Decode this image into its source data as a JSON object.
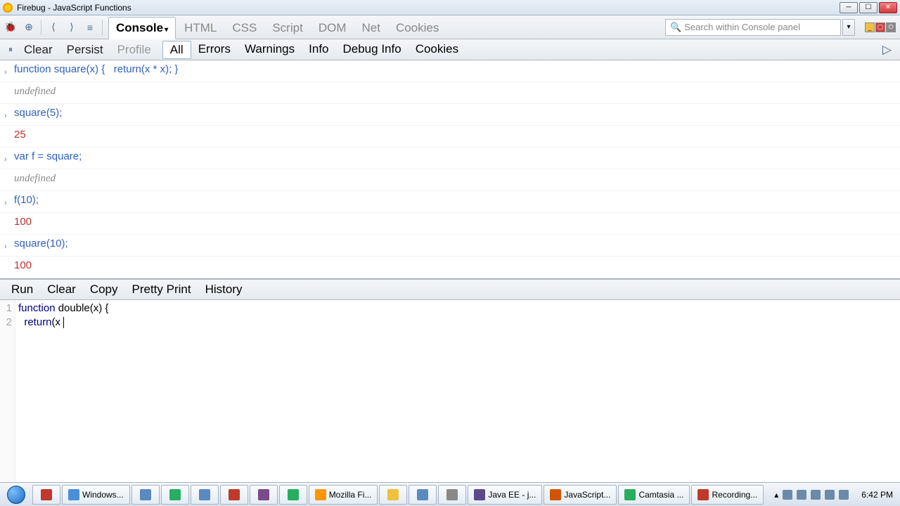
{
  "window": {
    "title": "Firebug - JavaScript Functions"
  },
  "panel_tabs": [
    "Console",
    "HTML",
    "CSS",
    "Script",
    "DOM",
    "Net",
    "Cookies"
  ],
  "active_panel": "Console",
  "search": {
    "placeholder": "Search within Console panel"
  },
  "console_toolbar": {
    "clear": "Clear",
    "persist": "Persist",
    "profile": "Profile"
  },
  "filters": [
    "All",
    "Errors",
    "Warnings",
    "Info",
    "Debug Info",
    "Cookies"
  ],
  "selected_filter": "All",
  "log": [
    {
      "kind": "cmd",
      "text": "function square(x) {   return(x * x); }"
    },
    {
      "kind": "undef",
      "text": "undefined"
    },
    {
      "kind": "cmd",
      "text": "square(5);"
    },
    {
      "kind": "out",
      "text": "25"
    },
    {
      "kind": "cmd",
      "text": "var f = square;"
    },
    {
      "kind": "undef",
      "text": "undefined"
    },
    {
      "kind": "cmd",
      "text": "f(10);"
    },
    {
      "kind": "out",
      "text": "100"
    },
    {
      "kind": "cmd",
      "text": "square(10);"
    },
    {
      "kind": "out",
      "text": "100"
    }
  ],
  "editor_toolbar": [
    "Run",
    "Clear",
    "Copy",
    "Pretty Print",
    "History"
  ],
  "editor_lines": [
    {
      "n": "1",
      "tokens": [
        [
          "kw",
          "function"
        ],
        [
          "plain",
          " double(x) {"
        ]
      ]
    },
    {
      "n": "2",
      "tokens": [
        [
          "plain",
          "  "
        ],
        [
          "kw",
          "return"
        ],
        [
          "plain",
          "(x "
        ]
      ],
      "caret": true
    }
  ],
  "taskbar": {
    "items": [
      {
        "label": "",
        "ico": "#c0392b"
      },
      {
        "label": "Windows...",
        "ico": "#4a90d9"
      },
      {
        "label": "",
        "ico": "#5a8ac0"
      },
      {
        "label": "",
        "ico": "#27ae60"
      },
      {
        "label": "",
        "ico": "#5a8ac0"
      },
      {
        "label": "",
        "ico": "#c0392b"
      },
      {
        "label": "",
        "ico": "#7a4a8a"
      },
      {
        "label": "",
        "ico": "#27ae60"
      },
      {
        "label": "Mozilla Fi...",
        "ico": "#ff9500"
      },
      {
        "label": "",
        "ico": "#f0c040"
      },
      {
        "label": "",
        "ico": "#5a8ac0"
      },
      {
        "label": "",
        "ico": "#888"
      },
      {
        "label": "Java EE - j...",
        "ico": "#5a4a8a"
      },
      {
        "label": "JavaScript...",
        "ico": "#d35400"
      },
      {
        "label": "Camtasia ...",
        "ico": "#27ae60"
      },
      {
        "label": "Recording...",
        "ico": "#c0392b"
      }
    ],
    "time": "6:42 PM"
  }
}
